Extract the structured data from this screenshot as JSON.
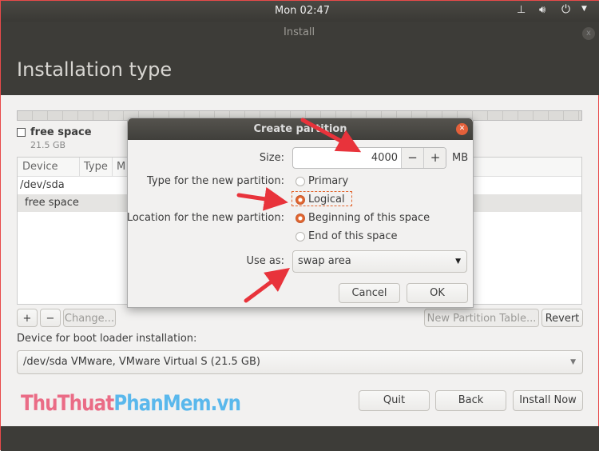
{
  "topbar": {
    "clock": "Mon 02:47",
    "icons": [
      "network-icon",
      "volume-icon",
      "power-icon",
      "chevron-down-icon"
    ]
  },
  "window": {
    "title": "Install",
    "page_title": "Installation type"
  },
  "partition_legend": {
    "name": "free space",
    "size": "21.5 GB"
  },
  "table": {
    "columns": [
      "Device",
      "Type",
      "M"
    ],
    "rows": [
      "/dev/sda",
      "free space"
    ]
  },
  "toolbar": {
    "add": "+",
    "remove": "−",
    "change": "Change...",
    "new_table": "New Partition Table...",
    "revert": "Revert"
  },
  "bootloader": {
    "label": "Device for boot loader installation:",
    "value": "/dev/sda VMware, VMware Virtual S (21.5 GB)"
  },
  "buttons": {
    "quit": "Quit",
    "back": "Back",
    "install": "Install Now"
  },
  "watermark": {
    "part1": "ThuThuat",
    "part2": "PhanMem",
    "part3": ".vn"
  },
  "dialog": {
    "title": "Create partition",
    "size_label": "Size:",
    "size_value": "4000",
    "size_unit": "MB",
    "minus": "−",
    "plus": "+",
    "type_label": "Type for the new partition:",
    "type_primary": "Primary",
    "type_logical": "Logical",
    "type_selected": "Logical",
    "location_label": "Location for the new partition:",
    "loc_begin": "Beginning of this space",
    "loc_end": "End of this space",
    "loc_selected": "Beginning of this space",
    "use_as_label": "Use as:",
    "use_as_value": "swap area",
    "cancel": "Cancel",
    "ok": "OK"
  },
  "colors": {
    "accent": "#e2662f",
    "arrow": "#e8333b"
  }
}
